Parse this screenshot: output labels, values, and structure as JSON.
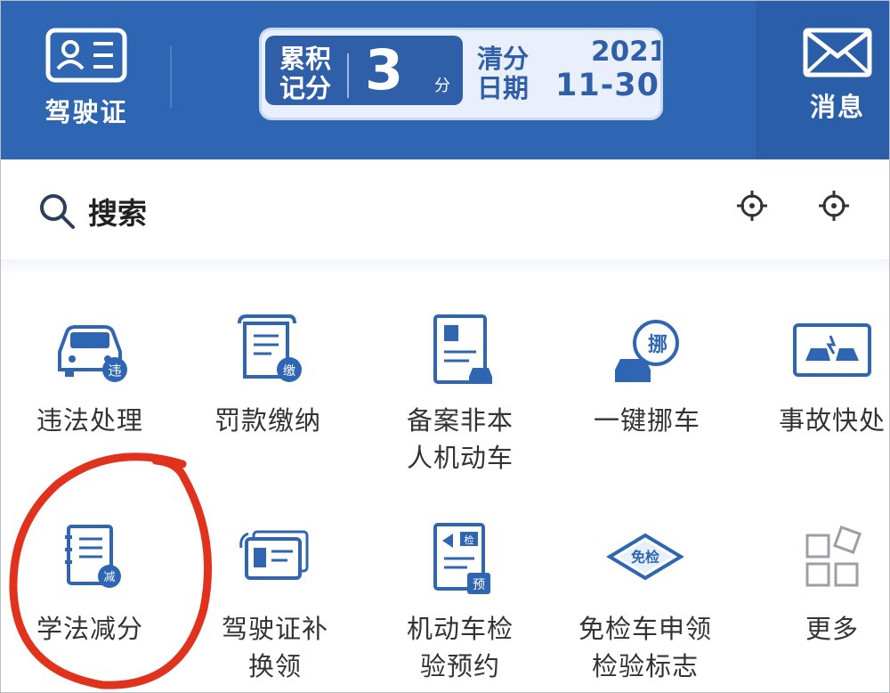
{
  "header": {
    "license_label": "驾驶证",
    "message_label": "消息",
    "points_card": {
      "title_line1": "累积",
      "title_line2": "记分",
      "points": "3",
      "points_unit": "分",
      "clear_line1": "清分",
      "clear_line2": "日期",
      "clear_year": "2021",
      "clear_date": "11-30"
    }
  },
  "search": {
    "label": "搜索"
  },
  "services": {
    "row1": [
      {
        "label": "违法处理",
        "badge": "违"
      },
      {
        "label": "罚款缴纳",
        "badge": "缴"
      },
      {
        "label_line1": "备案非本",
        "label_line2": "人机动车"
      },
      {
        "label": "一键挪车",
        "badge": "挪"
      },
      {
        "label": "事故快处"
      }
    ],
    "row2": [
      {
        "label": "学法减分",
        "badge": "减"
      },
      {
        "label_line1": "驾驶证补",
        "label_line2": "换领"
      },
      {
        "label_line1": "机动车检",
        "label_line2": "验预约",
        "badge": "预",
        "badge_top": "检"
      },
      {
        "label_line1": "免检车申领",
        "label_line2": "检验标志",
        "badge": "免检"
      },
      {
        "label": "更多"
      }
    ]
  },
  "icons": {
    "license": "id-card-icon",
    "message": "envelope-icon",
    "search": "search-icon",
    "location": "crosshair-icon"
  },
  "colors": {
    "brand_blue": "#2f66b3",
    "icon_blue": "#2f66b3",
    "annotation_red": "#e0321c"
  }
}
